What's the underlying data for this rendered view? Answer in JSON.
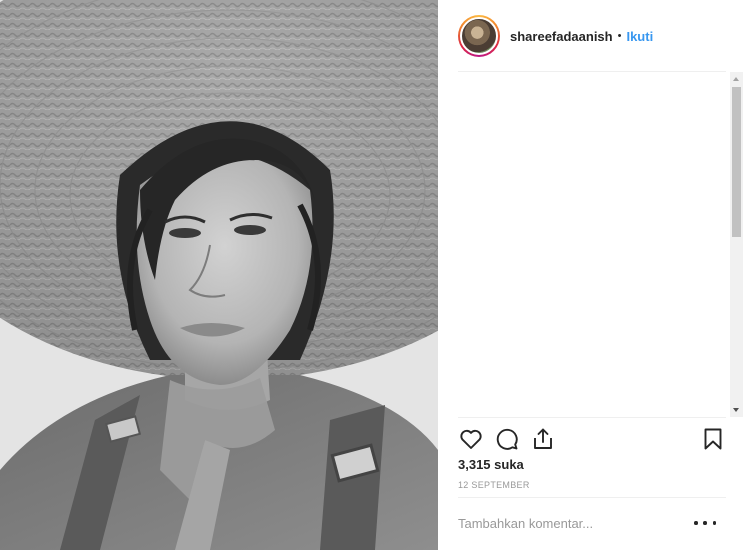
{
  "post": {
    "photo": {
      "icon": "portrait-photo",
      "description_style": "grayscale"
    },
    "header": {
      "username": "shareefadaanish",
      "separator": "•",
      "follow_label": "Ikuti"
    },
    "actions": {
      "like_icon": "heart-icon",
      "comment_icon": "comment-icon",
      "share_icon": "share-icon",
      "save_icon": "bookmark-icon"
    },
    "likes_text": "3,315 suka",
    "date_text": "12 SEPTEMBER",
    "comment": {
      "placeholder": "Tambahkan komentar..."
    },
    "options_icon": "more-options-icon",
    "colors": {
      "follow": "#3897f0",
      "text": "#262626",
      "muted": "#999999",
      "divider": "#efefef"
    }
  }
}
